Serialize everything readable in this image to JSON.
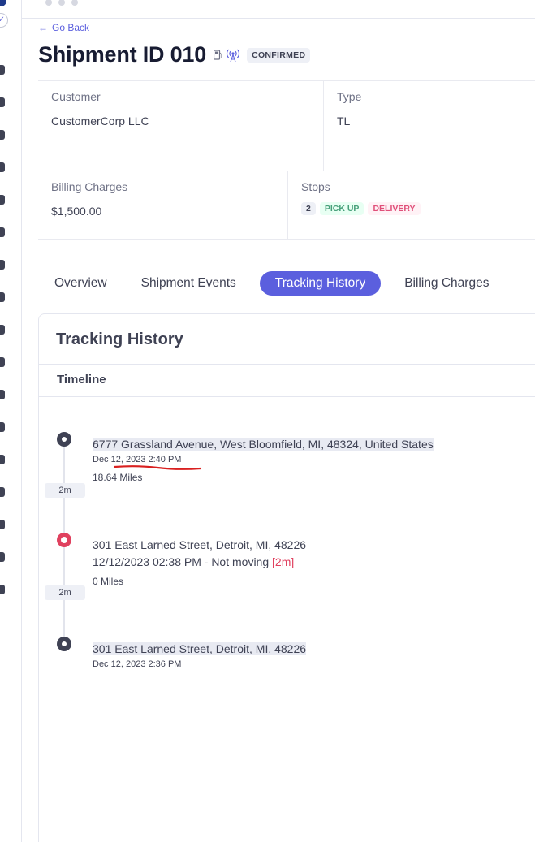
{
  "nav": {
    "back_label": "Go Back"
  },
  "header": {
    "title": "Shipment ID 010",
    "status_badge": "CONFIRMED"
  },
  "info": {
    "customer_label": "Customer",
    "customer_value": "CustomerCorp LLC",
    "type_label": "Type",
    "type_value": "TL",
    "billing_label": "Billing Charges",
    "billing_value": "$1,500.00",
    "stops_label": "Stops",
    "stops_count": "2",
    "stops_pickup": "PICK UP",
    "stops_delivery": "DELIVERY"
  },
  "tabs": [
    {
      "label": "Overview",
      "active": false
    },
    {
      "label": "Shipment Events",
      "active": false
    },
    {
      "label": "Tracking History",
      "active": true
    },
    {
      "label": "Billing Charges",
      "active": false
    }
  ],
  "tracking": {
    "card_title": "Tracking History",
    "timeline_heading": "Timeline",
    "events": [
      {
        "address": "6777 Grassland Avenue, West Bloomfield, MI, 48324, United States",
        "time": "Dec 12, 2023 2:40 PM",
        "miles": "18.64 Miles",
        "duration": "2m"
      },
      {
        "address": "301 East Larned Street, Detroit, MI, 48226",
        "status_text": "12/12/2023 02:38 PM - Not moving",
        "status_duration": "[2m]",
        "miles": "0 Miles",
        "duration": "2m"
      },
      {
        "address": "301 East Larned Street, Detroit, MI, 48226",
        "time": "Dec 12, 2023 2:36 PM"
      }
    ]
  },
  "colors": {
    "accent": "#5b5fde",
    "alert": "#e0415f",
    "pickup": "#47a07a",
    "delivery": "#e0507a"
  },
  "icons": [
    "fuel-pump-icon",
    "antenna-icon",
    "arrow-left-icon"
  ]
}
